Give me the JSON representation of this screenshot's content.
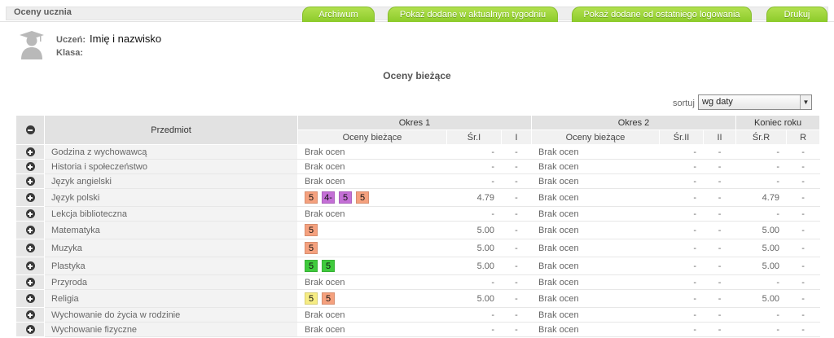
{
  "header": {
    "title": "Oceny ucznia",
    "tabs": [
      {
        "label": "Archiwum"
      },
      {
        "label": "Pokaż dodane w aktualnym tygodniu"
      },
      {
        "label": "Pokaż dodane od ostatniego logowania"
      },
      {
        "label": "Drukuj"
      }
    ]
  },
  "student": {
    "name_label": "Uczeń:",
    "name_value": "Imię i nazwisko",
    "class_label": "Klasa:",
    "class_value": ""
  },
  "section": {
    "title": "Oceny bieżące"
  },
  "sort": {
    "label": "sortuj",
    "selected": "wg daty"
  },
  "colors": {
    "salmon": "#f5a17e",
    "purple": "#c46fd6",
    "green": "#3fca3c",
    "yellow": "#f6ec83",
    "tab_green": "#9cd43a"
  },
  "table": {
    "headers": {
      "subject": "Przedmiot",
      "period1": "Okres 1",
      "period2": "Okres 2",
      "year_end": "Koniec roku",
      "p1_current": "Oceny bieżące",
      "p1_avg": "Śr.I",
      "p1_final": "I",
      "p2_current": "Oceny bieżące",
      "p2_avg": "Śr.II",
      "p2_final": "II",
      "year_avg": "Śr.R",
      "year_final": "R"
    },
    "rows": [
      {
        "subject": "Godzina z wychowawcą",
        "p1_text": "Brak ocen",
        "p1_grades": [],
        "p1_avg": "-",
        "p1_final": "-",
        "p2_text": "Brak ocen",
        "p2_avg": "-",
        "p2_final": "-",
        "year_avg": "-",
        "year_final": "-"
      },
      {
        "subject": "Historia i społeczeństwo",
        "p1_text": "Brak ocen",
        "p1_grades": [],
        "p1_avg": "-",
        "p1_final": "-",
        "p2_text": "Brak ocen",
        "p2_avg": "-",
        "p2_final": "-",
        "year_avg": "-",
        "year_final": "-"
      },
      {
        "subject": "Język angielski",
        "p1_text": "Brak ocen",
        "p1_grades": [],
        "p1_avg": "-",
        "p1_final": "-",
        "p2_text": "Brak ocen",
        "p2_avg": "-",
        "p2_final": "-",
        "year_avg": "-",
        "year_final": "-"
      },
      {
        "subject": "Język polski",
        "p1_text": "",
        "p1_grades": [
          {
            "v": "5",
            "color": "salmon"
          },
          {
            "v": "4-",
            "color": "purple"
          },
          {
            "v": "5",
            "color": "purple"
          },
          {
            "v": "5",
            "color": "salmon"
          }
        ],
        "p1_avg": "4.79",
        "p1_final": "-",
        "p2_text": "Brak ocen",
        "p2_avg": "-",
        "p2_final": "-",
        "year_avg": "4.79",
        "year_final": "-"
      },
      {
        "subject": "Lekcja biblioteczna",
        "p1_text": "Brak ocen",
        "p1_grades": [],
        "p1_avg": "-",
        "p1_final": "-",
        "p2_text": "Brak ocen",
        "p2_avg": "-",
        "p2_final": "-",
        "year_avg": "-",
        "year_final": "-"
      },
      {
        "subject": "Matematyka",
        "p1_text": "",
        "p1_grades": [
          {
            "v": "5",
            "color": "salmon"
          }
        ],
        "p1_avg": "5.00",
        "p1_final": "-",
        "p2_text": "Brak ocen",
        "p2_avg": "-",
        "p2_final": "-",
        "year_avg": "5.00",
        "year_final": "-"
      },
      {
        "subject": "Muzyka",
        "p1_text": "",
        "p1_grades": [
          {
            "v": "5",
            "color": "salmon"
          }
        ],
        "p1_avg": "5.00",
        "p1_final": "-",
        "p2_text": "Brak ocen",
        "p2_avg": "-",
        "p2_final": "-",
        "year_avg": "5.00",
        "year_final": "-"
      },
      {
        "subject": "Plastyka",
        "p1_text": "",
        "p1_grades": [
          {
            "v": "5",
            "color": "green"
          },
          {
            "v": "5",
            "color": "green"
          }
        ],
        "p1_avg": "5.00",
        "p1_final": "-",
        "p2_text": "Brak ocen",
        "p2_avg": "-",
        "p2_final": "-",
        "year_avg": "5.00",
        "year_final": "-"
      },
      {
        "subject": "Przyroda",
        "p1_text": "Brak ocen",
        "p1_grades": [],
        "p1_avg": "-",
        "p1_final": "-",
        "p2_text": "Brak ocen",
        "p2_avg": "-",
        "p2_final": "-",
        "year_avg": "-",
        "year_final": "-"
      },
      {
        "subject": "Religia",
        "p1_text": "",
        "p1_grades": [
          {
            "v": "5",
            "color": "yellow"
          },
          {
            "v": "5",
            "color": "salmon"
          }
        ],
        "p1_avg": "5.00",
        "p1_final": "-",
        "p2_text": "Brak ocen",
        "p2_avg": "-",
        "p2_final": "-",
        "year_avg": "5.00",
        "year_final": "-"
      },
      {
        "subject": "Wychowanie do życia w rodzinie",
        "p1_text": "Brak ocen",
        "p1_grades": [],
        "p1_avg": "-",
        "p1_final": "-",
        "p2_text": "Brak ocen",
        "p2_avg": "-",
        "p2_final": "-",
        "year_avg": "-",
        "year_final": "-"
      },
      {
        "subject": "Wychowanie fizyczne",
        "p1_text": "Brak ocen",
        "p1_grades": [],
        "p1_avg": "-",
        "p1_final": "-",
        "p2_text": "Brak ocen",
        "p2_avg": "-",
        "p2_final": "-",
        "year_avg": "-",
        "year_final": "-"
      }
    ]
  }
}
